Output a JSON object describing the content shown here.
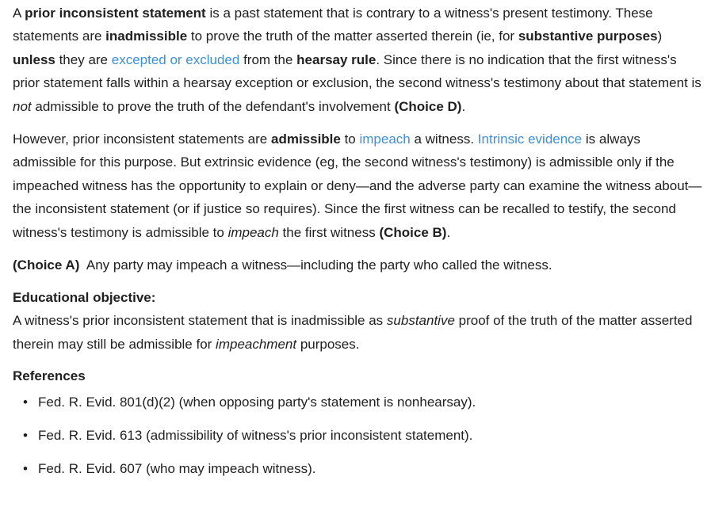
{
  "p1": {
    "s1_pre": "A ",
    "s1_term": "prior inconsistent statement",
    "s1_post": " is a past statement that is contrary to a witness's present testimony. These statements are ",
    "s2_bold": "inadmissible",
    "s2_mid": " to prove the truth of the matter asserted therein (ie, for ",
    "s2_bold2": "substantive purposes",
    "s2_post": ") ",
    "unless": "unless",
    "s3_mid": " they are ",
    "link": "excepted or excluded",
    "s3_post": " from the ",
    "hearsay": "hearsay rule",
    "s4": ".  Since there is no indication that the first witness's prior statement falls within a hearsay exception or exclusion, the second witness's testimony about that statement is ",
    "not": "not",
    "s5": " admissible to prove the truth of the defendant's involvement ",
    "choice": "(Choice D)",
    "end": "."
  },
  "p2": {
    "s1": "However, prior inconsistent statements are ",
    "admissible": "admissible",
    "s2": " to ",
    "link_impeach": "impeach",
    "s3": " a witness.  ",
    "link_intrinsic": "Intrinsic evidence",
    "s4": " is always admissible for this purpose.  But extrinsic evidence (eg, the second witness's testimony) is admissible only if the impeached witness has the opportunity to explain or deny—and the adverse party can examine the witness about—the inconsistent statement (or if justice so requires).  Since the first witness can be recalled to testify, the second witness's testimony is admissible to ",
    "impeach_italic": "impeach",
    "s5": " the first witness ",
    "choice": "(Choice B)",
    "end": "."
  },
  "p3": {
    "choice": "(Choice A)",
    "text": "  Any party may impeach a witness—including the party who called the witness."
  },
  "objective": {
    "heading": "Educational objective:",
    "s1": "A witness's prior inconsistent statement that is inadmissible as ",
    "substantive": "substantive",
    "s2": " proof of the truth of the matter asserted therein may still be admissible for ",
    "impeachment": "impeachment",
    "s3": " purposes."
  },
  "references": {
    "heading": "References",
    "items": [
      "Fed. R. Evid. 801(d)(2) (when opposing party's statement is nonhearsay).",
      "Fed. R. Evid. 613 (admissibility of witness's prior inconsistent statement).",
      "Fed. R. Evid. 607 (who may impeach witness)."
    ],
    "bullet": "•"
  },
  "colors": {
    "text": "#202020",
    "link": "#3d8fd6"
  }
}
